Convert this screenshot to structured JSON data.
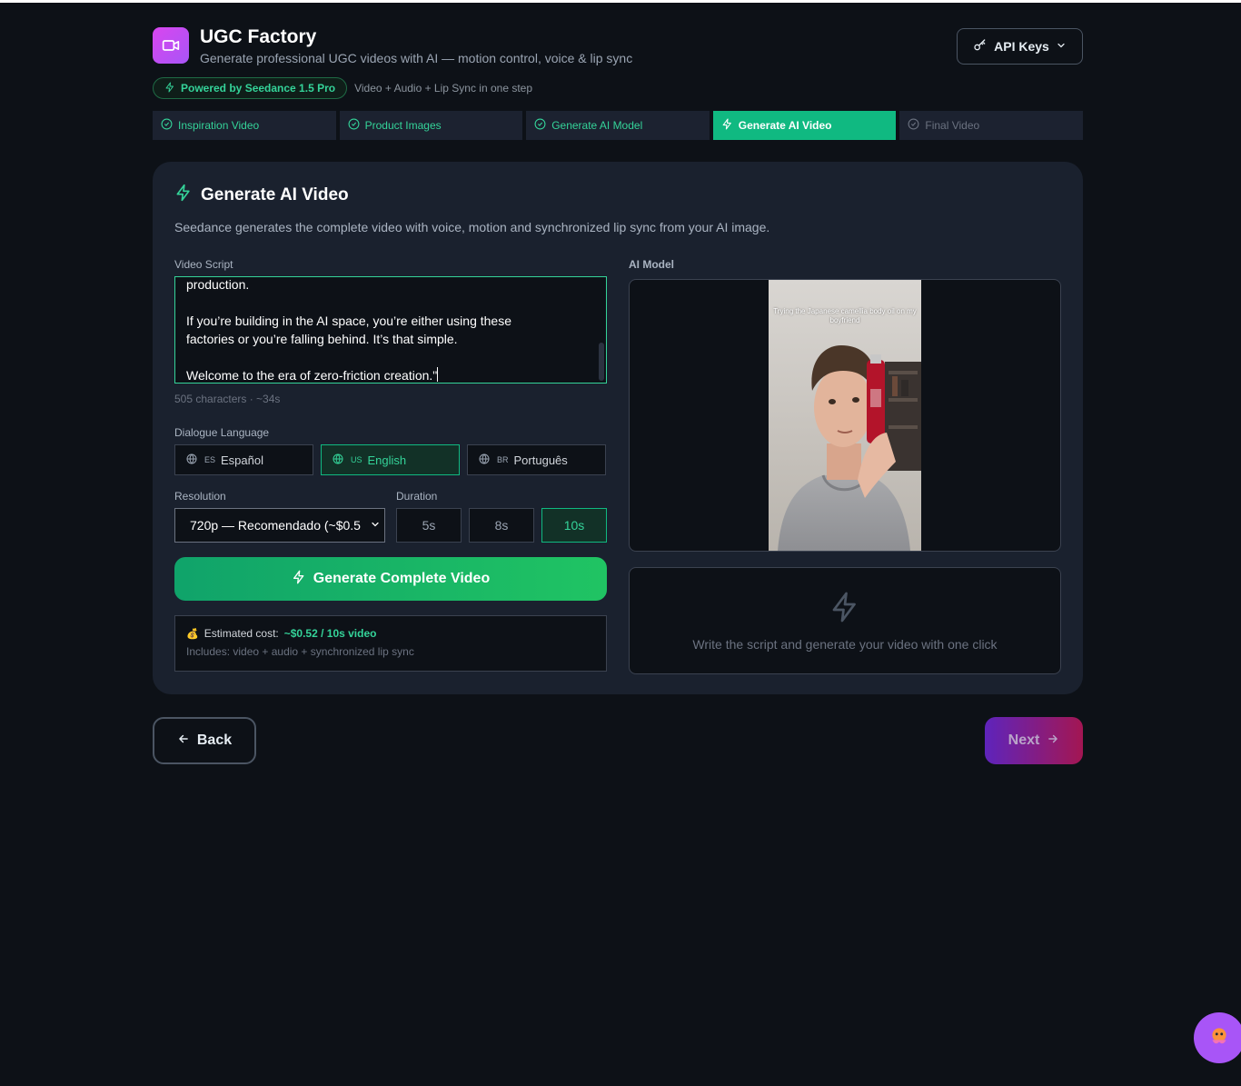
{
  "app": {
    "title": "UGC Factory",
    "subtitle": "Generate professional UGC videos with AI — motion control, voice & lip sync",
    "api_keys_label": "API Keys",
    "powered_by": "Powered by Seedance 1.5 Pro",
    "powered_note": "Video + Audio + Lip Sync in one step"
  },
  "steps": [
    {
      "label": "Inspiration Video",
      "state": "done"
    },
    {
      "label": "Product Images",
      "state": "done"
    },
    {
      "label": "Generate AI Model",
      "state": "done"
    },
    {
      "label": "Generate AI Video",
      "state": "active"
    },
    {
      "label": "Final Video",
      "state": "pending"
    }
  ],
  "card": {
    "title": "Generate AI Video",
    "description": "Seedance generates the complete video with voice, motion and synchronized lip sync from your AI image."
  },
  "script": {
    "label": "Video Script",
    "visible_text": "production.\n\nIf you’re building in the AI space, you’re either using these\nfactories or you’re falling behind. It’s that simple.\n\nWelcome to the era of zero-friction creation.\"",
    "meta": "505 characters · ~34s"
  },
  "language": {
    "label": "Dialogue Language",
    "options": [
      {
        "code": "ES",
        "label": "Español",
        "active": false
      },
      {
        "code": "US",
        "label": "English",
        "active": true
      },
      {
        "code": "BR",
        "label": "Português",
        "active": false
      }
    ]
  },
  "resolution": {
    "label": "Resolution",
    "selected": "720p — Recomendado (~$0.5"
  },
  "duration": {
    "label": "Duration",
    "options": [
      "5s",
      "8s",
      "10s"
    ],
    "selected": "10s"
  },
  "generate_button": "Generate Complete Video",
  "cost": {
    "prefix": "Estimated cost:",
    "value": "~$0.52 / 10s video",
    "includes": "Includes: video + audio + synchronized lip sync"
  },
  "model": {
    "label": "AI Model",
    "image_caption": "Trying the Japanese camellia body oil on my boyfriend"
  },
  "result_placeholder": "Write the script and generate your video with one click",
  "nav": {
    "back": "Back",
    "next": "Next"
  },
  "colors": {
    "accent": "#10b981",
    "background": "#0d1117",
    "card": "#1a212e",
    "brand": "#d946ef"
  },
  "icons": [
    "video-icon",
    "key-icon",
    "chevron-down-icon",
    "bolt-icon",
    "check-circle-icon",
    "globe-icon",
    "arrow-left-icon",
    "arrow-right-icon",
    "assistant-icon"
  ]
}
